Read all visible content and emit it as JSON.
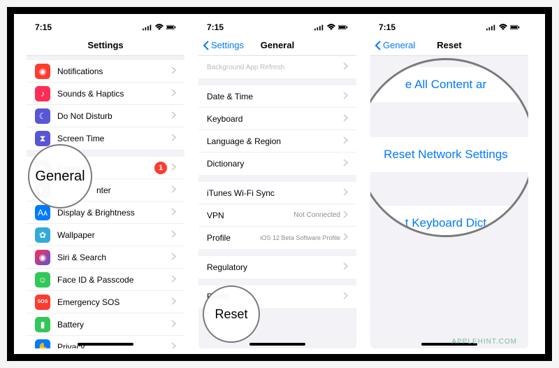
{
  "status": {
    "time": "7:15"
  },
  "panel1": {
    "title": "Settings",
    "rows_a": [
      {
        "label": "Notifications",
        "icon": "#ff3b30"
      },
      {
        "label": "Sounds & Haptics",
        "icon": "#ff2d55"
      },
      {
        "label": "Do Not Disturb",
        "icon": "#5856d6"
      },
      {
        "label": "Screen Time",
        "icon": "#5856d6"
      }
    ],
    "general": {
      "label": "General",
      "badge": "1"
    },
    "control_center_fragment": "nter",
    "rows_b": [
      {
        "label": "Display & Brightness",
        "icon": "#007aff"
      },
      {
        "label": "Wallpaper",
        "icon": "#34aadc"
      },
      {
        "label": "Siri & Search",
        "icon": "#222"
      },
      {
        "label": "Face ID & Passcode",
        "icon": "#33c759"
      },
      {
        "label": "Emergency SOS",
        "icon": "#ff3b30",
        "sos": "SOS"
      },
      {
        "label": "Battery",
        "icon": "#33c759"
      },
      {
        "label": "Privacy",
        "icon": "#007aff"
      }
    ],
    "mag": "General"
  },
  "panel2": {
    "back": "Settings",
    "title": "General",
    "row_top": "Background App Refresh",
    "rows_a": [
      {
        "label": "Date & Time"
      },
      {
        "label": "Keyboard"
      },
      {
        "label": "Language & Region"
      },
      {
        "label": "Dictionary"
      }
    ],
    "rows_b": [
      {
        "label": "iTunes Wi-Fi Sync"
      },
      {
        "label": "VPN",
        "detail": "Not Connected"
      },
      {
        "label": "Profile",
        "detail": "iOS 12 Beta Software Profile"
      }
    ],
    "rows_c": [
      {
        "label": "Regulatory"
      }
    ],
    "rows_d": [
      {
        "label": "Reset"
      }
    ],
    "mag": "Reset"
  },
  "panel3": {
    "back": "General",
    "title": "Reset",
    "mag_rows": {
      "top": "e All Content ar",
      "mid": "Reset Network Settings",
      "bot": "t Keyboard Dict"
    }
  },
  "watermark": "APPLEHINT.COM"
}
